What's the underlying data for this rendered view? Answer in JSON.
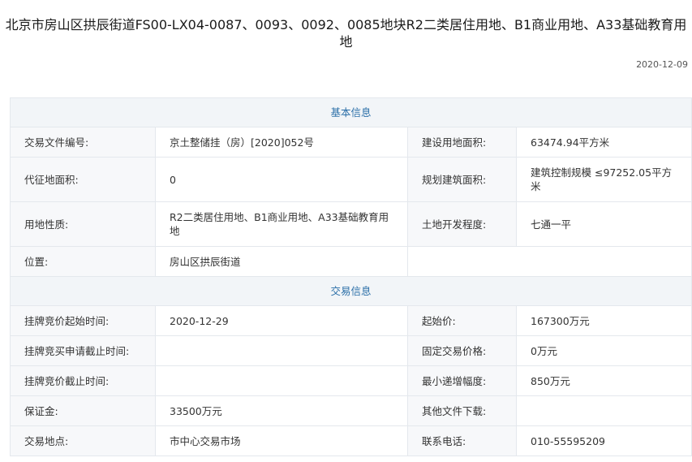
{
  "header": {
    "title_line1": "北京市房山区拱辰街道FS00-LX04-0087、0093、0092、0085地块R2二类居住用地、B1商业用地、A33基础教育用",
    "title_line2": "地",
    "date": "2020-12-09"
  },
  "sections": {
    "basic": "基本信息",
    "trade": "交易信息"
  },
  "basic": {
    "file_no_label": "交易文件编号:",
    "file_no_value": "京土整储挂（房）[2020]052号",
    "build_area_label": "建设用地面积:",
    "build_area_value": "63474.94平方米",
    "collect_area_label": "代征地面积:",
    "collect_area_value": "0",
    "plan_area_label": "规划建筑面积:",
    "plan_area_value": "建筑控制规模 ≤97252.05平方米",
    "use_label": "用地性质:",
    "use_value": "R2二类居住用地、B1商业用地、A33基础教育用地",
    "dev_label": "土地开发程度:",
    "dev_value": "七通一平",
    "location_label": "位置:",
    "location_value": "房山区拱辰街道"
  },
  "trade": {
    "start_time_label": "挂牌竞价起始时间:",
    "start_time_value": "2020-12-29",
    "start_price_label": "起始价:",
    "start_price_value": "167300万元",
    "apply_deadline_label": "挂牌竞买申请截止时间:",
    "apply_deadline_value": "",
    "fixed_price_label": "固定交易价格:",
    "fixed_price_value": "0万元",
    "bid_deadline_label": "挂牌竞价截止时间:",
    "bid_deadline_value": "",
    "min_increment_label": "最小递增幅度:",
    "min_increment_value": "850万元",
    "deposit_label": "保证金:",
    "deposit_value": "33500万元",
    "other_files_label": "其他文件下载:",
    "other_files_value": "",
    "place_label": "交易地点:",
    "place_value": "市中心交易市场",
    "phone_label": "联系电话:",
    "phone_value": "010-55595209"
  }
}
